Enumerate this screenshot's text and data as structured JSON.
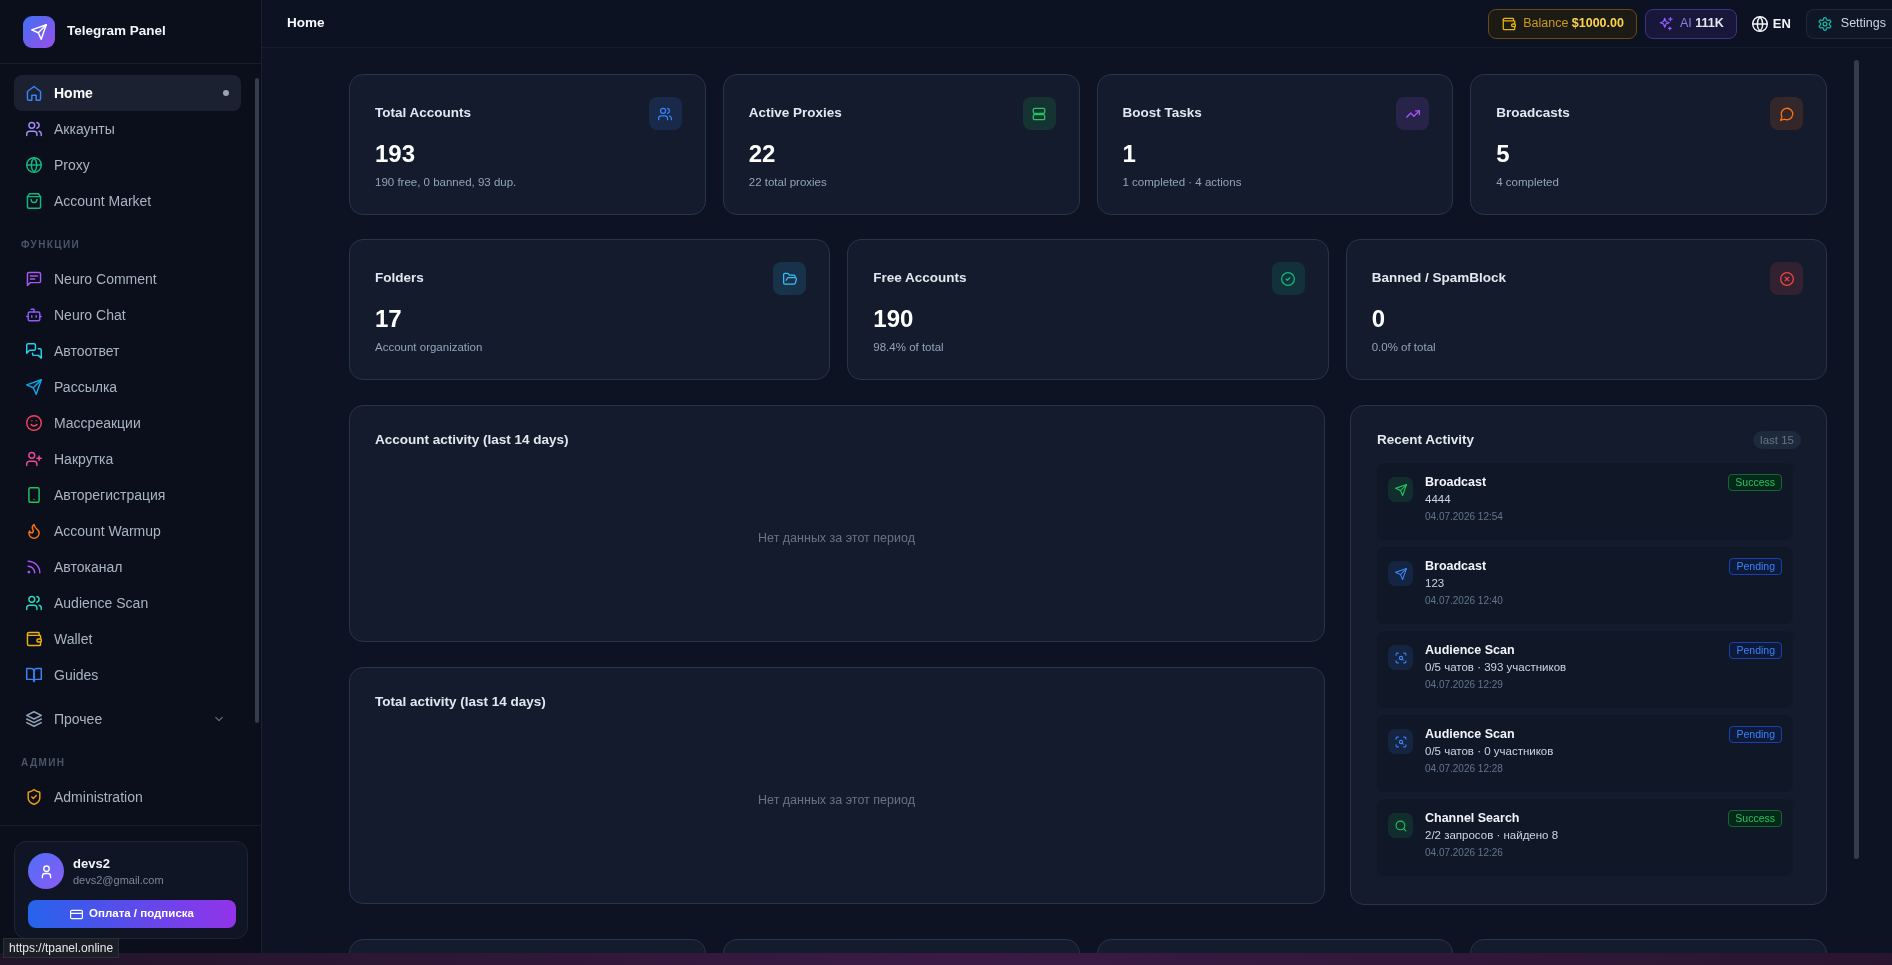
{
  "sidebar": {
    "brand": "Telegram Panel",
    "sections": [
      {
        "items": [
          {
            "label": "Home",
            "kind": "link",
            "selected": true
          },
          {
            "label": "Аккаунты",
            "kind": "link",
            "selected": false
          },
          {
            "label": "Proxy",
            "kind": "link",
            "selected": false
          },
          {
            "label": "Account Market",
            "kind": "link",
            "selected": false
          }
        ]
      },
      {
        "heading": "ФУНКЦИИ",
        "items": [
          {
            "label": "Neuro Comment",
            "kind": "link",
            "selected": false
          },
          {
            "label": "Neuro Chat",
            "kind": "link",
            "selected": false
          },
          {
            "label": "Автоответ",
            "kind": "link",
            "selected": false
          },
          {
            "label": "Рассылка",
            "kind": "link",
            "selected": false
          },
          {
            "label": "Массреакции",
            "kind": "link",
            "selected": false
          },
          {
            "label": "Накрутка",
            "kind": "link",
            "selected": false
          },
          {
            "label": "Авторегистрация",
            "kind": "link",
            "selected": false
          },
          {
            "label": "Account Warmup",
            "kind": "link",
            "selected": false
          },
          {
            "label": "Автоканал",
            "kind": "link",
            "selected": false
          },
          {
            "label": "Audience Scan",
            "kind": "link",
            "selected": false
          },
          {
            "label": "Wallet",
            "kind": "link",
            "selected": false
          },
          {
            "label": "Guides",
            "kind": "link",
            "selected": false
          },
          {
            "label": "Прочее",
            "kind": "group",
            "selected": false,
            "expanded": false
          }
        ]
      },
      {
        "heading": "АДМИН",
        "items": [
          {
            "label": "Administration",
            "kind": "link",
            "selected": false
          }
        ]
      }
    ],
    "user": {
      "name": "devs2",
      "email": "devs2@gmail.com",
      "button": "Оплата / подписка"
    }
  },
  "topbar": {
    "title": "Home",
    "balance": {
      "label": "Balance",
      "value": "$1000.00"
    },
    "ai": {
      "label": "AI",
      "value": "111K"
    },
    "language": "EN",
    "settings": "Settings"
  },
  "stat_rows": [
    {
      "cards": [
        {
          "title": "Total Accounts",
          "value": "193",
          "detail": "190 free, 0 banned, 93 dup."
        },
        {
          "title": "Active Proxies",
          "value": "22",
          "detail": "22 total proxies"
        },
        {
          "title": "Boost Tasks",
          "value": "1",
          "detail": "1 completed · 4 actions"
        },
        {
          "title": "Broadcasts",
          "value": "5",
          "detail": "4 completed"
        }
      ]
    },
    {
      "cards": [
        {
          "title": "Folders",
          "value": "17",
          "detail": "Account organization"
        },
        {
          "title": "Free Accounts",
          "value": "190",
          "detail": "98.4% of total"
        },
        {
          "title": "Banned / SpamBlock",
          "value": "0",
          "detail": "0.0% of total"
        }
      ]
    }
  ],
  "activity_charts": [
    {
      "title": "Account activity (last 14 days)",
      "empty_text": "Нет данных за этот период"
    },
    {
      "title": "Total activity (last 14 days)",
      "empty_text": "Нет данных за этот период"
    }
  ],
  "recent_activity": {
    "title": "Recent Activity",
    "count": "last 15",
    "items": [
      {
        "kind": "broadcast",
        "title": "Broadcast",
        "detail": "4444",
        "time": "04.07.2026 12:54",
        "badge": {
          "kind": "success",
          "label": "Success"
        }
      },
      {
        "kind": "broadcast",
        "title": "Broadcast",
        "detail": "123",
        "time": "04.07.2026 12:40",
        "badge": {
          "kind": "pending",
          "label": "Pending"
        }
      },
      {
        "kind": "audience_scan",
        "title": "Audience Scan",
        "detail": "0/5 чатов · 393 участников",
        "time": "04.07.2026 12:29",
        "badge": {
          "kind": "pending",
          "label": "Pending"
        }
      },
      {
        "kind": "audience_scan",
        "title": "Audience Scan",
        "detail": "0/5 чатов · 0 участников",
        "time": "04.07.2026 12:28",
        "badge": {
          "kind": "pending",
          "label": "Pending"
        }
      },
      {
        "kind": "channel_search",
        "title": "Channel Search",
        "detail": "2/2 запросов · найдено 8",
        "time": "04.07.2026 12:26",
        "badge": {
          "kind": "success",
          "label": "Success"
        }
      }
    ]
  },
  "status_bar": {
    "url": "https://tpanel.online"
  }
}
